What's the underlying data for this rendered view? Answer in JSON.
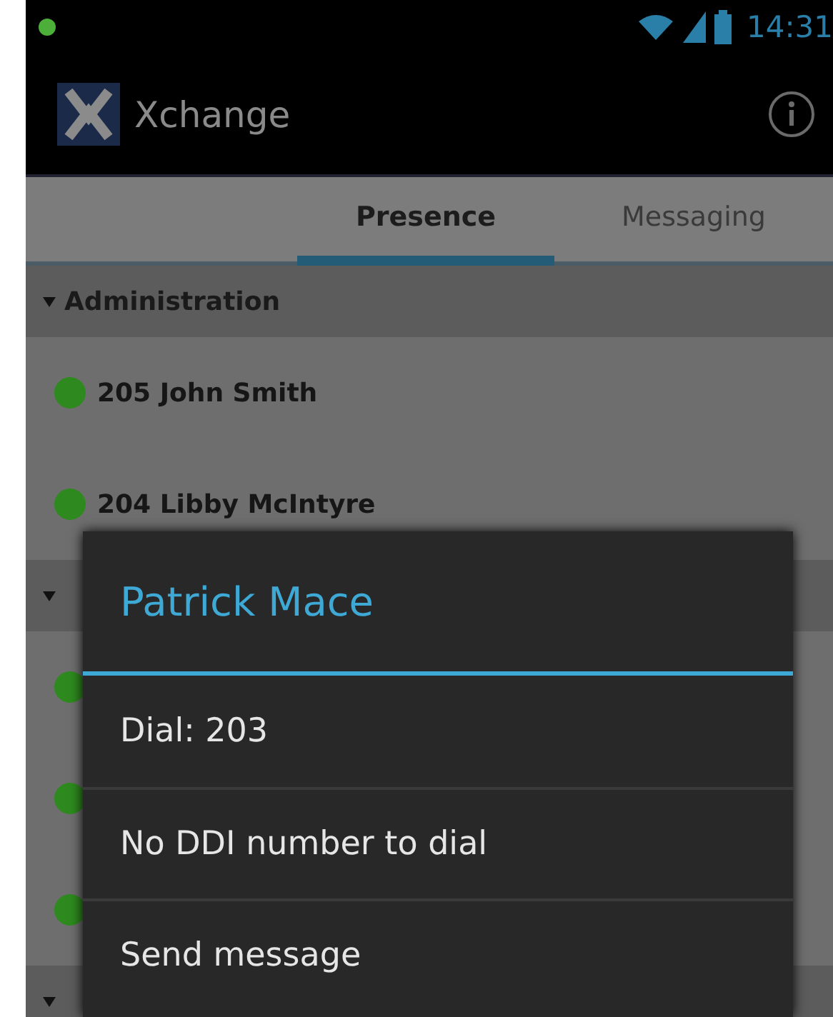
{
  "status_bar": {
    "time": "14:31"
  },
  "action_bar": {
    "title": "Xchange"
  },
  "tabs": [
    {
      "label": "Presence",
      "selected": true
    },
    {
      "label": "Messaging",
      "selected": false
    }
  ],
  "groups": [
    {
      "name": "Administration",
      "expanded": true,
      "contacts": [
        {
          "name": "205 John Smith",
          "online": true
        },
        {
          "name": "204 Libby McIntyre",
          "online": true
        }
      ]
    },
    {
      "expanded": true,
      "contacts": [
        {
          "online": true
        },
        {
          "online": true
        },
        {
          "online": true
        }
      ]
    },
    {
      "expanded": true
    }
  ],
  "dialog": {
    "title": "Patrick Mace",
    "items": [
      "Dial: 203",
      "No DDI number to dial",
      "Send message"
    ]
  }
}
